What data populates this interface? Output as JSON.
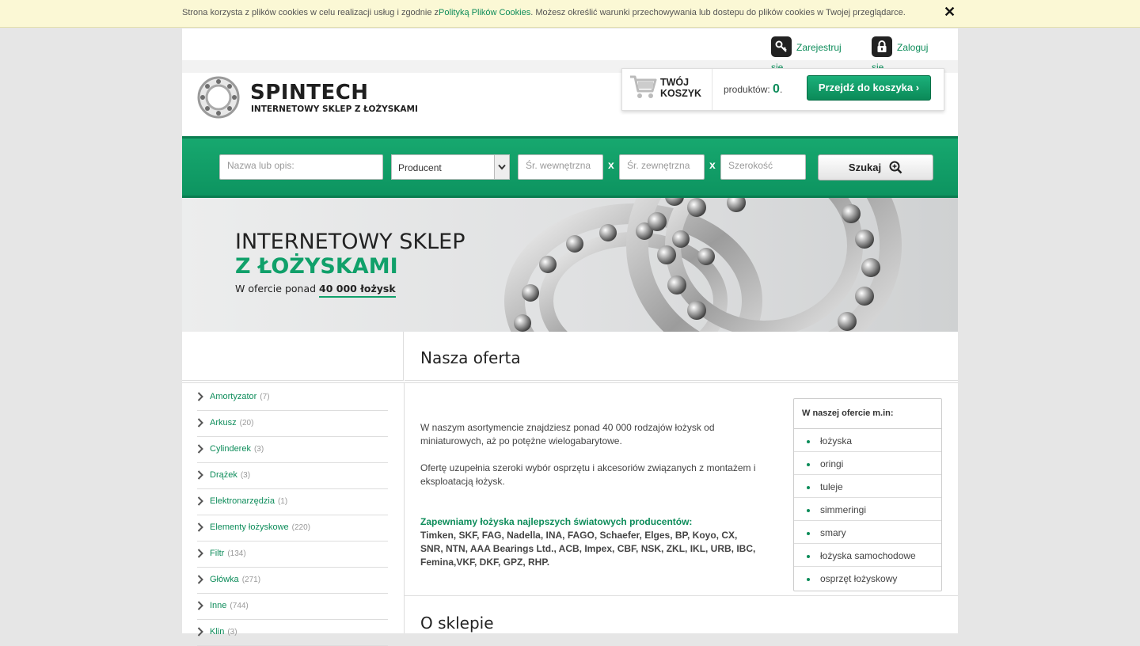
{
  "cookie": {
    "text_before": "Strona korzysta z plików cookies w celu realizacji usług i zgodnie z",
    "link": "Polityką Plików Cookies",
    "text_after": ". Możesz określić warunki przechowywania lub dostepu do plików cookies w Twojej przeglądarce.",
    "close": "✕"
  },
  "account": {
    "register_label": "Zarejestruj",
    "register_label2": "się",
    "login_label": "Zaloguj",
    "login_label2": "się"
  },
  "logo": {
    "title": "SPINTECH",
    "subtitle": "INTERNETOWY SKLEP Z ŁOŻYSKAMI"
  },
  "cart": {
    "title_line1": "TWÓJ",
    "title_line2": "KOSZYK",
    "count_label": "produktów:",
    "count_value": "0",
    "count_suffix": ".",
    "button_label": "Przejdź do koszyka ›"
  },
  "search": {
    "name_placeholder": "Nazwa lub opis:",
    "producer_value": "Producent",
    "inner_placeholder": "Śr. wewnętrzna",
    "outer_placeholder": "Śr. zewnętrzna",
    "width_placeholder": "Szerokość",
    "separator": "x",
    "button_label": "Szukaj"
  },
  "banner": {
    "line1": "INTERNETOWY SKLEP",
    "line2": "Z ŁOŻYSKAMI",
    "line3_prefix": "W ofercie ponad ",
    "line3_highlight": "40 000 łożysk"
  },
  "categories": [
    {
      "label": "Amortyzator",
      "count": "(7)"
    },
    {
      "label": "Arkusz",
      "count": "(20)"
    },
    {
      "label": "Cylinderek",
      "count": "(3)"
    },
    {
      "label": "Drążek",
      "count": "(3)"
    },
    {
      "label": "Elektronarzędzia",
      "count": "(1)"
    },
    {
      "label": "Elementy łożyskowe",
      "count": "(220)"
    },
    {
      "label": "Filtr",
      "count": "(134)"
    },
    {
      "label": "Główka",
      "count": "(271)"
    },
    {
      "label": "Inne",
      "count": "(744)"
    },
    {
      "label": "Klin",
      "count": "(3)"
    }
  ],
  "main": {
    "title": "Nasza oferta",
    "para1": "W naszym asortymencie znajdziesz ponad 40 000 rodzajów łożysk od miniaturowych, aż po potężne wielogabarytowe.",
    "para2": "Ofertę uzupełnia szeroki wybór osprzętu i akcesoriów związanych z montażem i eksploatacją łożysk.",
    "para3_title": "Zapewniamy łożyska najlepszych światowych producentów:",
    "para3_body": "Timken, SKF, FAG, Nadella, INA, FAGO, Schaefer, Elges, BP, Koyo, CX, SNR, NTN, AAA Bearings Ltd., ACB, Impex, CBF, NSK, ZKL, IKL, URB, IBC, Femina,VKF, DKF, GPZ, RHP.",
    "offer_box_title": "W naszej ofercie m.in:",
    "offer_items": [
      "łożyska",
      "oringi",
      "tuleje",
      "simmeringi",
      "smary",
      "łożyska samochodowe",
      "osprzęt łożyskowy"
    ],
    "section2_title": "O sklepie"
  },
  "colors": {
    "accent": "#0d8c5a",
    "bar_green": "#17a86f",
    "cookie_bg": "#fbf8d5"
  }
}
